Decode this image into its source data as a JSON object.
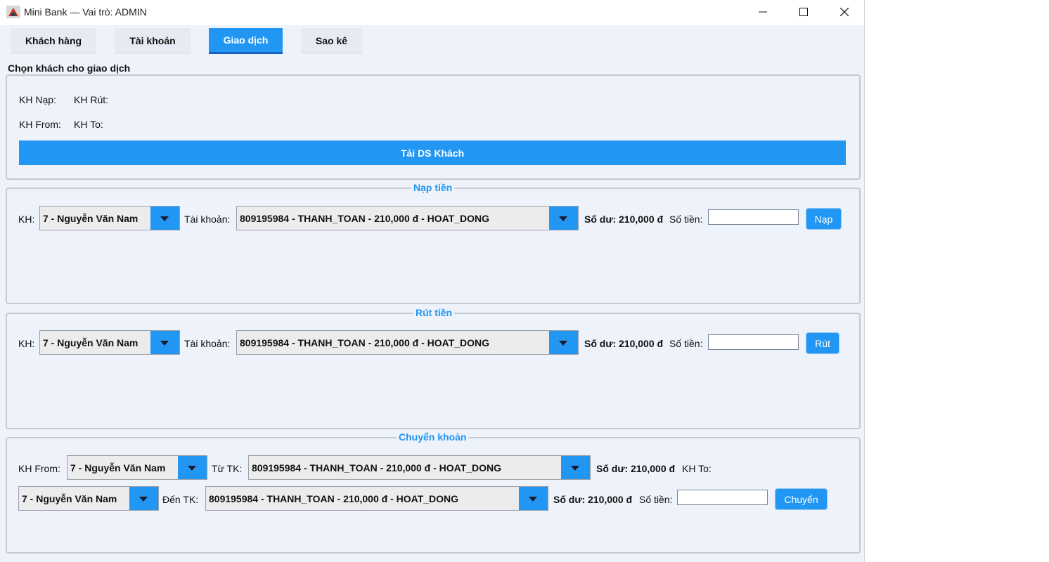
{
  "window": {
    "title": "Mini Bank — Vai trò: ADMIN",
    "controls": {
      "minimize": "—",
      "maximize": "☐",
      "close": "✕"
    }
  },
  "tabs": [
    {
      "label": "Khách hàng"
    },
    {
      "label": "Tài khoản"
    },
    {
      "label": "Giao dịch",
      "active": true
    },
    {
      "label": "Sao kê"
    }
  ],
  "chooser": {
    "heading": "Chọn khách cho giao dịch",
    "kh_nap": "KH Nạp:",
    "kh_rut": "KH Rút:",
    "kh_from": "KH From:",
    "kh_to": "KH To:",
    "load_button": "Tải DS Khách"
  },
  "deposit": {
    "title": "Nạp tiền",
    "kh_label": "KH:",
    "customer": "7 - Nguyễn Văn Nam",
    "account_label": "Tài khoản:",
    "account": "809195984 - THANH_TOAN - 210,000 đ - HOAT_DONG",
    "balance": "Số dư: 210,000 đ",
    "amount_label": "Số tiền:",
    "amount_value": "",
    "button": "Nạp"
  },
  "withdraw": {
    "title": "Rút tiền",
    "kh_label": "KH:",
    "customer": "7 - Nguyễn Văn Nam",
    "account_label": "Tài khoản:",
    "account": "809195984 - THANH_TOAN - 210,000 đ - HOAT_DONG",
    "balance": "Số dư: 210,000 đ",
    "amount_label": "Số tiền:",
    "amount_value": "",
    "button": "Rút"
  },
  "transfer": {
    "title": "Chuyển khoản",
    "from_label": "KH From:",
    "from_customer": "7 - Nguyễn Văn Nam",
    "from_account_label": "Từ TK:",
    "from_account": "809195984 - THANH_TOAN - 210,000 đ - HOAT_DONG",
    "from_balance": "Số dư: 210,000 đ",
    "to_label": "KH To:",
    "to_customer": "7 - Nguyễn Văn Nam",
    "to_account_label": "Đến TK:",
    "to_account": "809195984 - THANH_TOAN - 210,000 đ - HOAT_DONG",
    "to_balance": "Số dư: 210,000 đ",
    "amount_label": "Số tiền:",
    "amount_value": "",
    "button": "Chuyển"
  },
  "colors": {
    "accent": "#2196f3",
    "background": "#eef2fa"
  }
}
